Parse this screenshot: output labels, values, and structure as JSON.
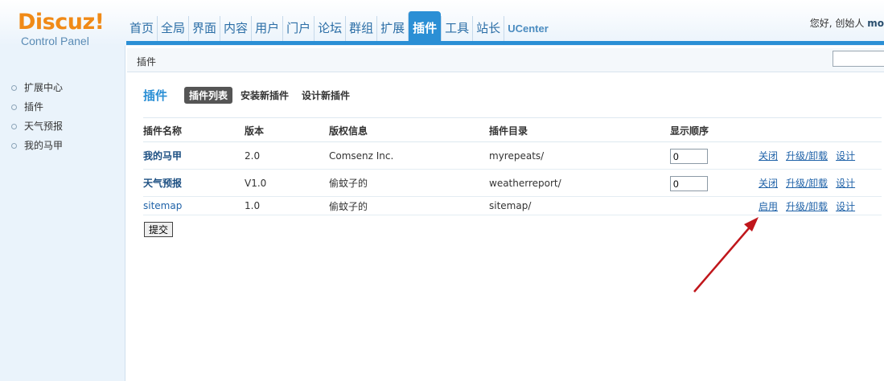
{
  "logo": {
    "word": "Discuz!",
    "sub": "Control Panel"
  },
  "topnav": [
    {
      "label": "首页",
      "active": false
    },
    {
      "label": "全局",
      "active": false
    },
    {
      "label": "界面",
      "active": false
    },
    {
      "label": "内容",
      "active": false
    },
    {
      "label": "用户",
      "active": false
    },
    {
      "label": "门户",
      "active": false
    },
    {
      "label": "论坛",
      "active": false
    },
    {
      "label": "群组",
      "active": false
    },
    {
      "label": "扩展",
      "active": false
    },
    {
      "label": "插件",
      "active": true
    },
    {
      "label": "工具",
      "active": false
    },
    {
      "label": "站长",
      "active": false
    },
    {
      "label": "UCenter",
      "active": false
    }
  ],
  "greeting": {
    "text": "您好, 创始人",
    "user": "mo"
  },
  "breadcrumb": "插件",
  "sidebar": {
    "items": [
      {
        "label": "扩展中心"
      },
      {
        "label": "插件"
      },
      {
        "label": "天气预报"
      },
      {
        "label": "我的马甲"
      }
    ]
  },
  "main": {
    "title": "插件",
    "tabs": [
      {
        "label": "插件列表",
        "active": true
      },
      {
        "label": "安装新插件",
        "active": false
      },
      {
        "label": "设计新插件",
        "active": false
      }
    ],
    "columns": [
      "插件名称",
      "版本",
      "版权信息",
      "插件目录",
      "显示顺序",
      ""
    ],
    "rows": [
      {
        "name": "我的马甲",
        "version": "2.0",
        "copyright": "Comsenz Inc.",
        "dir": "myrepeats/",
        "order": "0",
        "toggle": "关闭",
        "upgrade": "升级/卸载",
        "design": "设计",
        "bold": true,
        "has_order": true
      },
      {
        "name": "天气预报",
        "version": "V1.0",
        "copyright": "偷蚊子的",
        "dir": "weatherreport/",
        "order": "0",
        "toggle": "关闭",
        "upgrade": "升级/卸载",
        "design": "设计",
        "bold": true,
        "has_order": true
      },
      {
        "name": "sitemap",
        "version": "1.0",
        "copyright": "偷蚊子的",
        "dir": "sitemap/",
        "order": "",
        "toggle": "启用",
        "upgrade": "升级/卸载",
        "design": "设计",
        "bold": false,
        "has_order": false
      }
    ],
    "submit_label": "提交"
  },
  "colors": {
    "accent": "#2b8fd5",
    "logo": "#f08a17",
    "arrow": "#c0161b"
  }
}
